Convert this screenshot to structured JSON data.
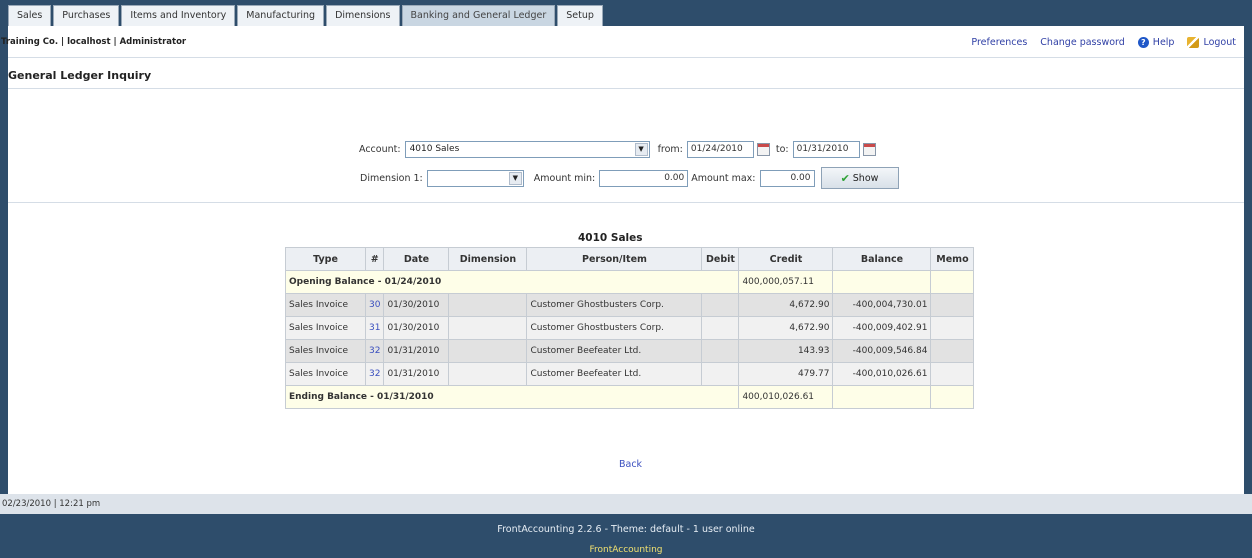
{
  "tabs": [
    {
      "label": "Sales",
      "active": false
    },
    {
      "label": "Purchases",
      "active": false
    },
    {
      "label": "Items and Inventory",
      "active": false
    },
    {
      "label": "Manufacturing",
      "active": false
    },
    {
      "label": "Dimensions",
      "active": false
    },
    {
      "label": "Banking and General Ledger",
      "active": true
    },
    {
      "label": "Setup",
      "active": false
    }
  ],
  "header": {
    "company": "Training Co. | localhost | Administrator",
    "links": {
      "preferences": "Preferences",
      "change_password": "Change password",
      "help": "Help",
      "logout": "Logout"
    }
  },
  "page": {
    "title": "General Ledger Inquiry"
  },
  "filters": {
    "account_label": "Account:",
    "account_value": "4010  Sales",
    "from_label": "from:",
    "from_value": "01/24/2010",
    "to_label": "to:",
    "to_value": "01/31/2010",
    "dimension_label": "Dimension 1:",
    "dimension_value": "",
    "amount_min_label": "Amount min:",
    "amount_min_value": "0.00",
    "amount_max_label": "Amount max:",
    "amount_max_value": "0.00",
    "show_label": "Show"
  },
  "table": {
    "title": "4010  Sales",
    "headers": [
      "Type",
      "#",
      "Date",
      "Dimension",
      "Person/Item",
      "Debit",
      "Credit",
      "Balance",
      "Memo"
    ],
    "opening": {
      "label": "Opening Balance - 01/24/2010",
      "credit": "400,000,057.11"
    },
    "rows": [
      {
        "type": "Sales Invoice",
        "num": "30",
        "date": "01/30/2010",
        "dimension": "",
        "person": "Customer Ghostbusters Corp.",
        "debit": "",
        "credit": "4,672.90",
        "balance": "-400,004,730.01",
        "memo": ""
      },
      {
        "type": "Sales Invoice",
        "num": "31",
        "date": "01/30/2010",
        "dimension": "",
        "person": "Customer Ghostbusters Corp.",
        "debit": "",
        "credit": "4,672.90",
        "balance": "-400,009,402.91",
        "memo": ""
      },
      {
        "type": "Sales Invoice",
        "num": "32",
        "date": "01/31/2010",
        "dimension": "",
        "person": "Customer Beefeater Ltd.",
        "debit": "",
        "credit": "143.93",
        "balance": "-400,009,546.84",
        "memo": ""
      },
      {
        "type": "Sales Invoice",
        "num": "32",
        "date": "01/31/2010",
        "dimension": "",
        "person": "Customer Beefeater Ltd.",
        "debit": "",
        "credit": "479.77",
        "balance": "-400,010,026.61",
        "memo": ""
      }
    ],
    "ending": {
      "label": "Ending Balance - 01/31/2010",
      "credit": "400,010,026.61"
    }
  },
  "back_label": "Back",
  "status": {
    "datetime": "02/23/2010 | 12:21 pm"
  },
  "footer": {
    "line1": "FrontAccounting 2.2.6 - Theme: default - 1 user online",
    "line2": "FrontAccounting"
  },
  "colors": {
    "chrome": "#2e4d6b",
    "link": "#3a4fbf",
    "balance_row": "#fefee8"
  }
}
